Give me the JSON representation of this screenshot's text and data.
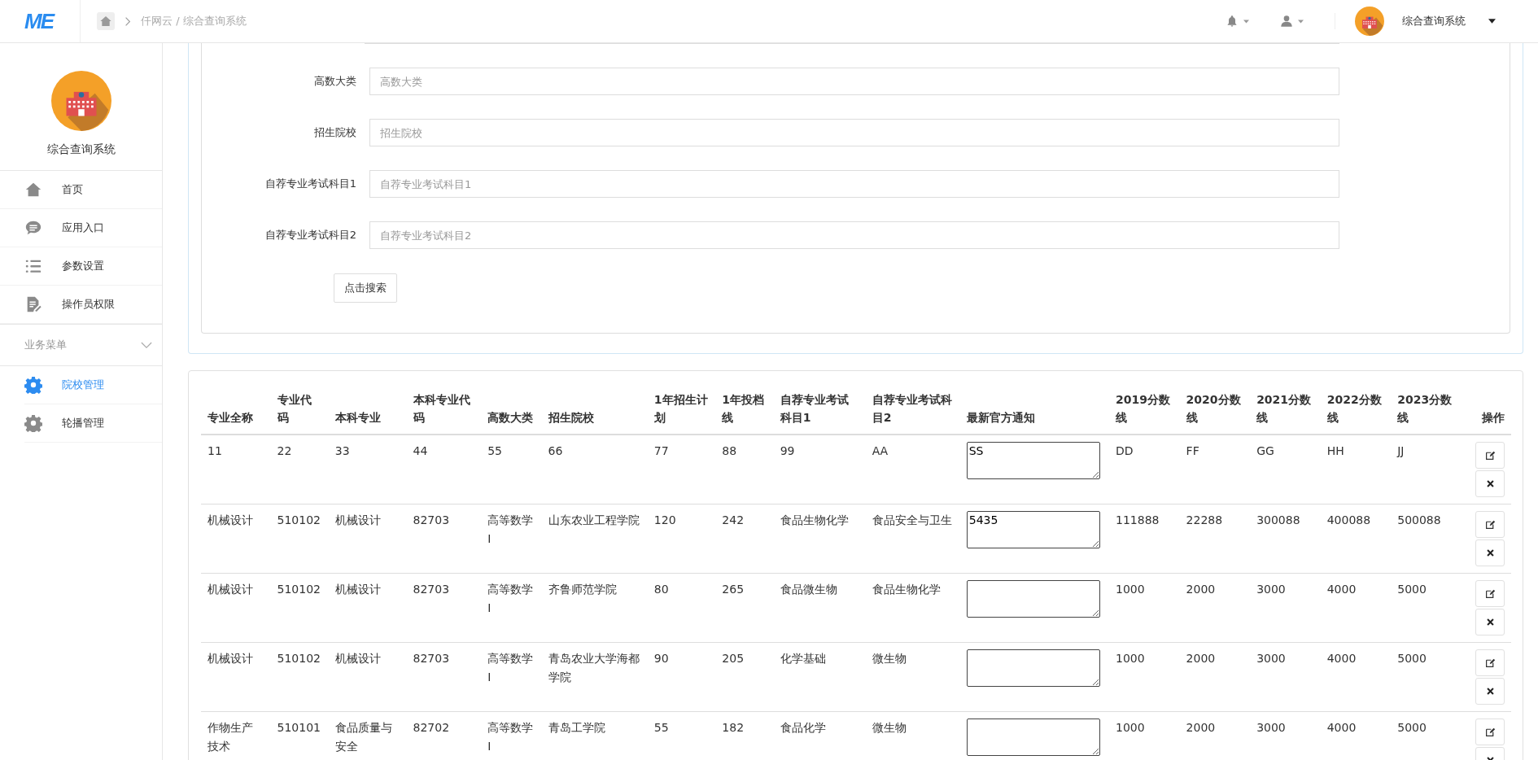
{
  "header": {
    "logo": "ME",
    "breadcrumb": "仟网云 / 综合查询系统",
    "account_name": "综合查询系统"
  },
  "sidebar": {
    "profile_name": "综合查询系统",
    "items": [
      {
        "label": "首页",
        "kind": "home",
        "selected": false
      },
      {
        "label": "应用入口",
        "kind": "chat",
        "selected": false
      },
      {
        "label": "参数设置",
        "kind": "list",
        "selected": false
      },
      {
        "label": "操作员权限",
        "kind": "doc",
        "selected": false
      }
    ],
    "section": {
      "title": "业务菜单",
      "expanded": true,
      "items": [
        {
          "label": "院校管理",
          "kind": "gear",
          "selected": true
        },
        {
          "label": "轮播管理",
          "kind": "gear",
          "selected": false
        }
      ]
    }
  },
  "search_form": {
    "fields": [
      {
        "label": "高数大类",
        "placeholder": "高数大类"
      },
      {
        "label": "招生院校",
        "placeholder": "招生院校"
      },
      {
        "label": "自荐专业考试科目1",
        "placeholder": "自荐专业考试科目1"
      },
      {
        "label": "自荐专业考试科目2",
        "placeholder": "自荐专业考试科目2"
      }
    ],
    "button": "点击搜索"
  },
  "table": {
    "columns": [
      "专业全称",
      "专业代码",
      "本科专业",
      "本科专业代码",
      "高数大类",
      "招生院校",
      "1年招生计划",
      "1年投档线",
      "自荐专业考试科目1",
      "自荐专业考试科目2",
      "最新官方通知",
      "2019分数线",
      "2020分数线",
      "2021分数线",
      "2022分数线",
      "2023分数线",
      "操作"
    ],
    "rows": [
      {
        "cells": [
          "11",
          "22",
          "33",
          "44",
          "55",
          "66",
          "77",
          "88",
          "99",
          "AA"
        ],
        "notice": "SS",
        "scores": [
          "DD",
          "FF",
          "GG",
          "HH",
          "JJ"
        ]
      },
      {
        "cells": [
          "机械设计",
          "510102",
          "机械设计",
          "82703",
          "高等数学Ⅰ",
          "山东农业工程学院",
          "120",
          "242",
          "食品生物化学",
          "食品安全与卫生"
        ],
        "notice": "5435",
        "scores": [
          "111888",
          "22288",
          "300088",
          "400088",
          "500088"
        ]
      },
      {
        "cells": [
          "机械设计",
          "510102",
          "机械设计",
          "82703",
          "高等数学Ⅰ",
          "齐鲁师范学院",
          "80",
          "265",
          "食品微生物",
          "食品生物化学"
        ],
        "notice": "",
        "scores": [
          "1000",
          "2000",
          "3000",
          "4000",
          "5000"
        ]
      },
      {
        "cells": [
          "机械设计",
          "510102",
          "机械设计",
          "82703",
          "高等数学Ⅰ",
          "青岛农业大学海都学院",
          "90",
          "205",
          "化学基础",
          "微生物"
        ],
        "notice": "",
        "scores": [
          "1000",
          "2000",
          "3000",
          "4000",
          "5000"
        ]
      },
      {
        "cells": [
          "作物生产技术",
          "510101",
          "食品质量与安全",
          "82702",
          "高等数学Ⅰ",
          "青岛工学院",
          "55",
          "182",
          "食品化学",
          "微生物"
        ],
        "notice": "",
        "scores": [
          "1000",
          "2000",
          "3000",
          "4000",
          "5000"
        ]
      }
    ]
  }
}
